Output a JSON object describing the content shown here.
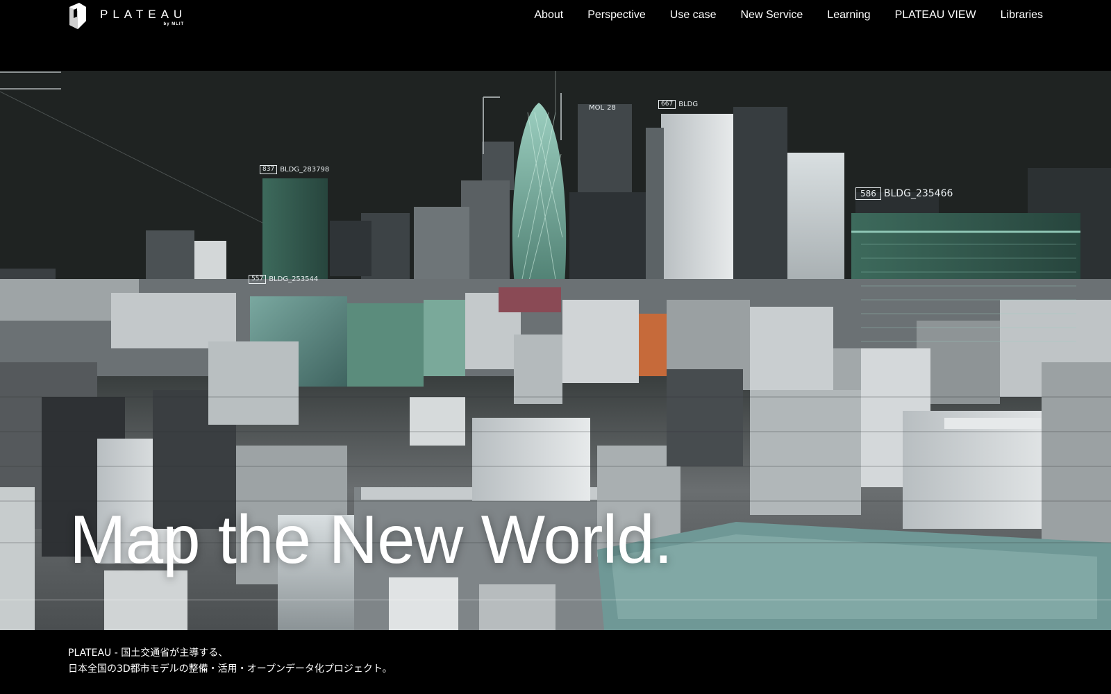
{
  "brand": {
    "name": "PLATEAU",
    "sub": "by MLIT"
  },
  "nav": {
    "items": [
      {
        "label": "About"
      },
      {
        "label": "Perspective"
      },
      {
        "label": "Use case"
      },
      {
        "label": "New Service"
      },
      {
        "label": "Learning"
      },
      {
        "label": "PLATEAU VIEW"
      },
      {
        "label": "Libraries"
      }
    ]
  },
  "hero": {
    "headline": "Map the New World.",
    "tags": [
      {
        "id": "837",
        "label": "BLDG_283798"
      },
      {
        "id": "586",
        "label": "BLDG_235466"
      },
      {
        "id": "557",
        "label": "BLDG_253544"
      },
      {
        "id": "667",
        "label": "BLDG"
      },
      {
        "id": "MOL",
        "label": "28"
      }
    ]
  },
  "intro": {
    "line1": "PLATEAU - 国土交通省が主導する、",
    "line2": "日本全国の3D都市モデルの整備・活用・オープンデータ化プロジェクト。"
  },
  "colors": {
    "background": "#000000",
    "text": "#ffffff"
  }
}
